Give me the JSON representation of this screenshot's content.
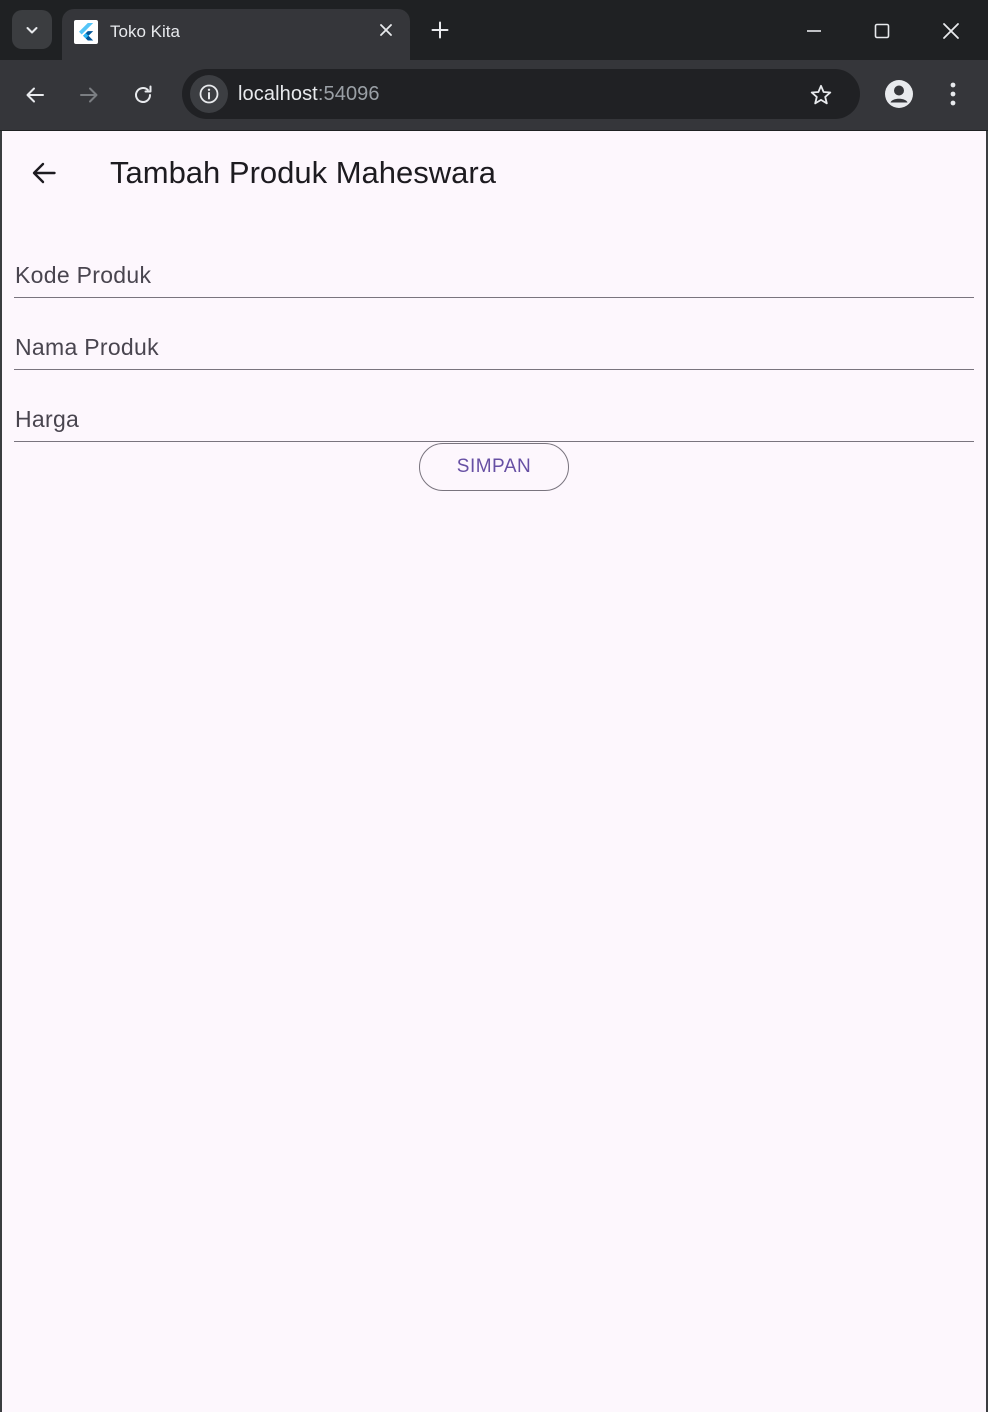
{
  "browser": {
    "tab": {
      "title": "Toko Kita",
      "favicon": "flutter-icon"
    },
    "new_tab_icon": "plus-icon",
    "window_controls": [
      "minimize-icon",
      "maximize-icon",
      "close-icon"
    ],
    "address": {
      "host": "localhost",
      "port": ":54096"
    },
    "colors": {
      "chrome_dark": "#1f2123",
      "toolbar": "#35363a",
      "omnibox": "#202124",
      "text": "#e8eaed"
    }
  },
  "app": {
    "title": "Tambah Produk Maheswara",
    "back_icon": "arrow-back-icon",
    "form": {
      "fields": [
        {
          "label": "Kode Produk",
          "value": ""
        },
        {
          "label": "Nama Produk",
          "value": ""
        },
        {
          "label": "Harga",
          "value": ""
        }
      ],
      "submit_label": "SIMPAN"
    },
    "colors": {
      "background": "#fdf7fd",
      "primary": "#6750a4",
      "outline": "#79747e",
      "on_surface": "#1d1b20"
    }
  }
}
